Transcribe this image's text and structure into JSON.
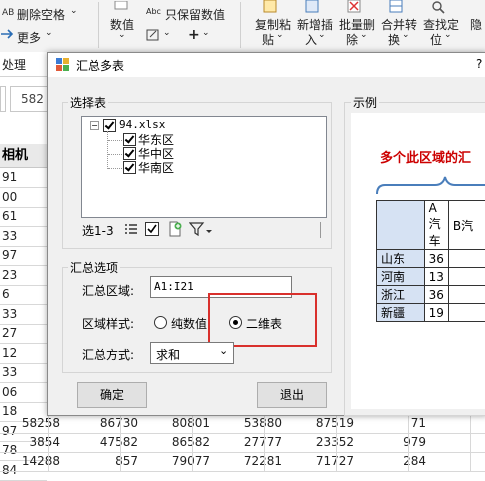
{
  "ribbon": {
    "delete_blank": "删除空格",
    "more": "更多",
    "numeric": "数值",
    "keep_numeric": "只保留数值",
    "copy_paste": [
      "复制粘",
      "贴"
    ],
    "add_insert": [
      "新增插",
      "入"
    ],
    "batch_delete": [
      "批量删",
      "除"
    ],
    "merge_convert": [
      "合并转",
      "换"
    ],
    "find_locate": [
      "查找定",
      "位"
    ],
    "hide": "隐",
    "process": "处理",
    "help": "?"
  },
  "sheet": {
    "name_box": "",
    "formula_value": "582",
    "col_header": "相机",
    "row_values": [
      "91",
      "00",
      "61",
      "33",
      "97",
      "23",
      "6",
      "33",
      "27",
      "12",
      "33",
      "06",
      "18",
      "97",
      "78",
      "84"
    ],
    "row16": [
      "58258",
      "86730",
      "80801",
      "53880",
      "87519",
      "71"
    ],
    "row17": [
      "3854",
      "47582",
      "86582",
      "27777",
      "23352",
      "979"
    ],
    "row18": [
      "14288",
      "857",
      "79077",
      "72281",
      "71727",
      "284"
    ]
  },
  "dialog": {
    "title": "汇总多表",
    "select_group": "选择表",
    "tree": {
      "root": "94.xlsx",
      "items": [
        "华东区",
        "华中区",
        "华南区"
      ]
    },
    "select_range": "选1-3",
    "options_group": "汇总选项",
    "range_label": "汇总区域:",
    "range_value": "A1:I21",
    "style_label": "区域样式:",
    "style_opt1": "纯数值",
    "style_opt2": "二维表",
    "method_label": "汇总方式:",
    "method_value": "求和",
    "ok": "确定",
    "exit": "退出",
    "example_group": "示例",
    "example_title": "多个此区域的汇",
    "example_headers": [
      "A汽车",
      "B汽"
    ],
    "example_rows": [
      {
        "label": "山东",
        "value": "36"
      },
      {
        "label": "河南",
        "value": "13"
      },
      {
        "label": "浙江",
        "value": "36"
      },
      {
        "label": "新疆",
        "value": "19"
      }
    ]
  },
  "colors": {
    "example_title": "#cc0000",
    "highlight_box": "#d9302c",
    "brace": "#4a7ebb"
  }
}
